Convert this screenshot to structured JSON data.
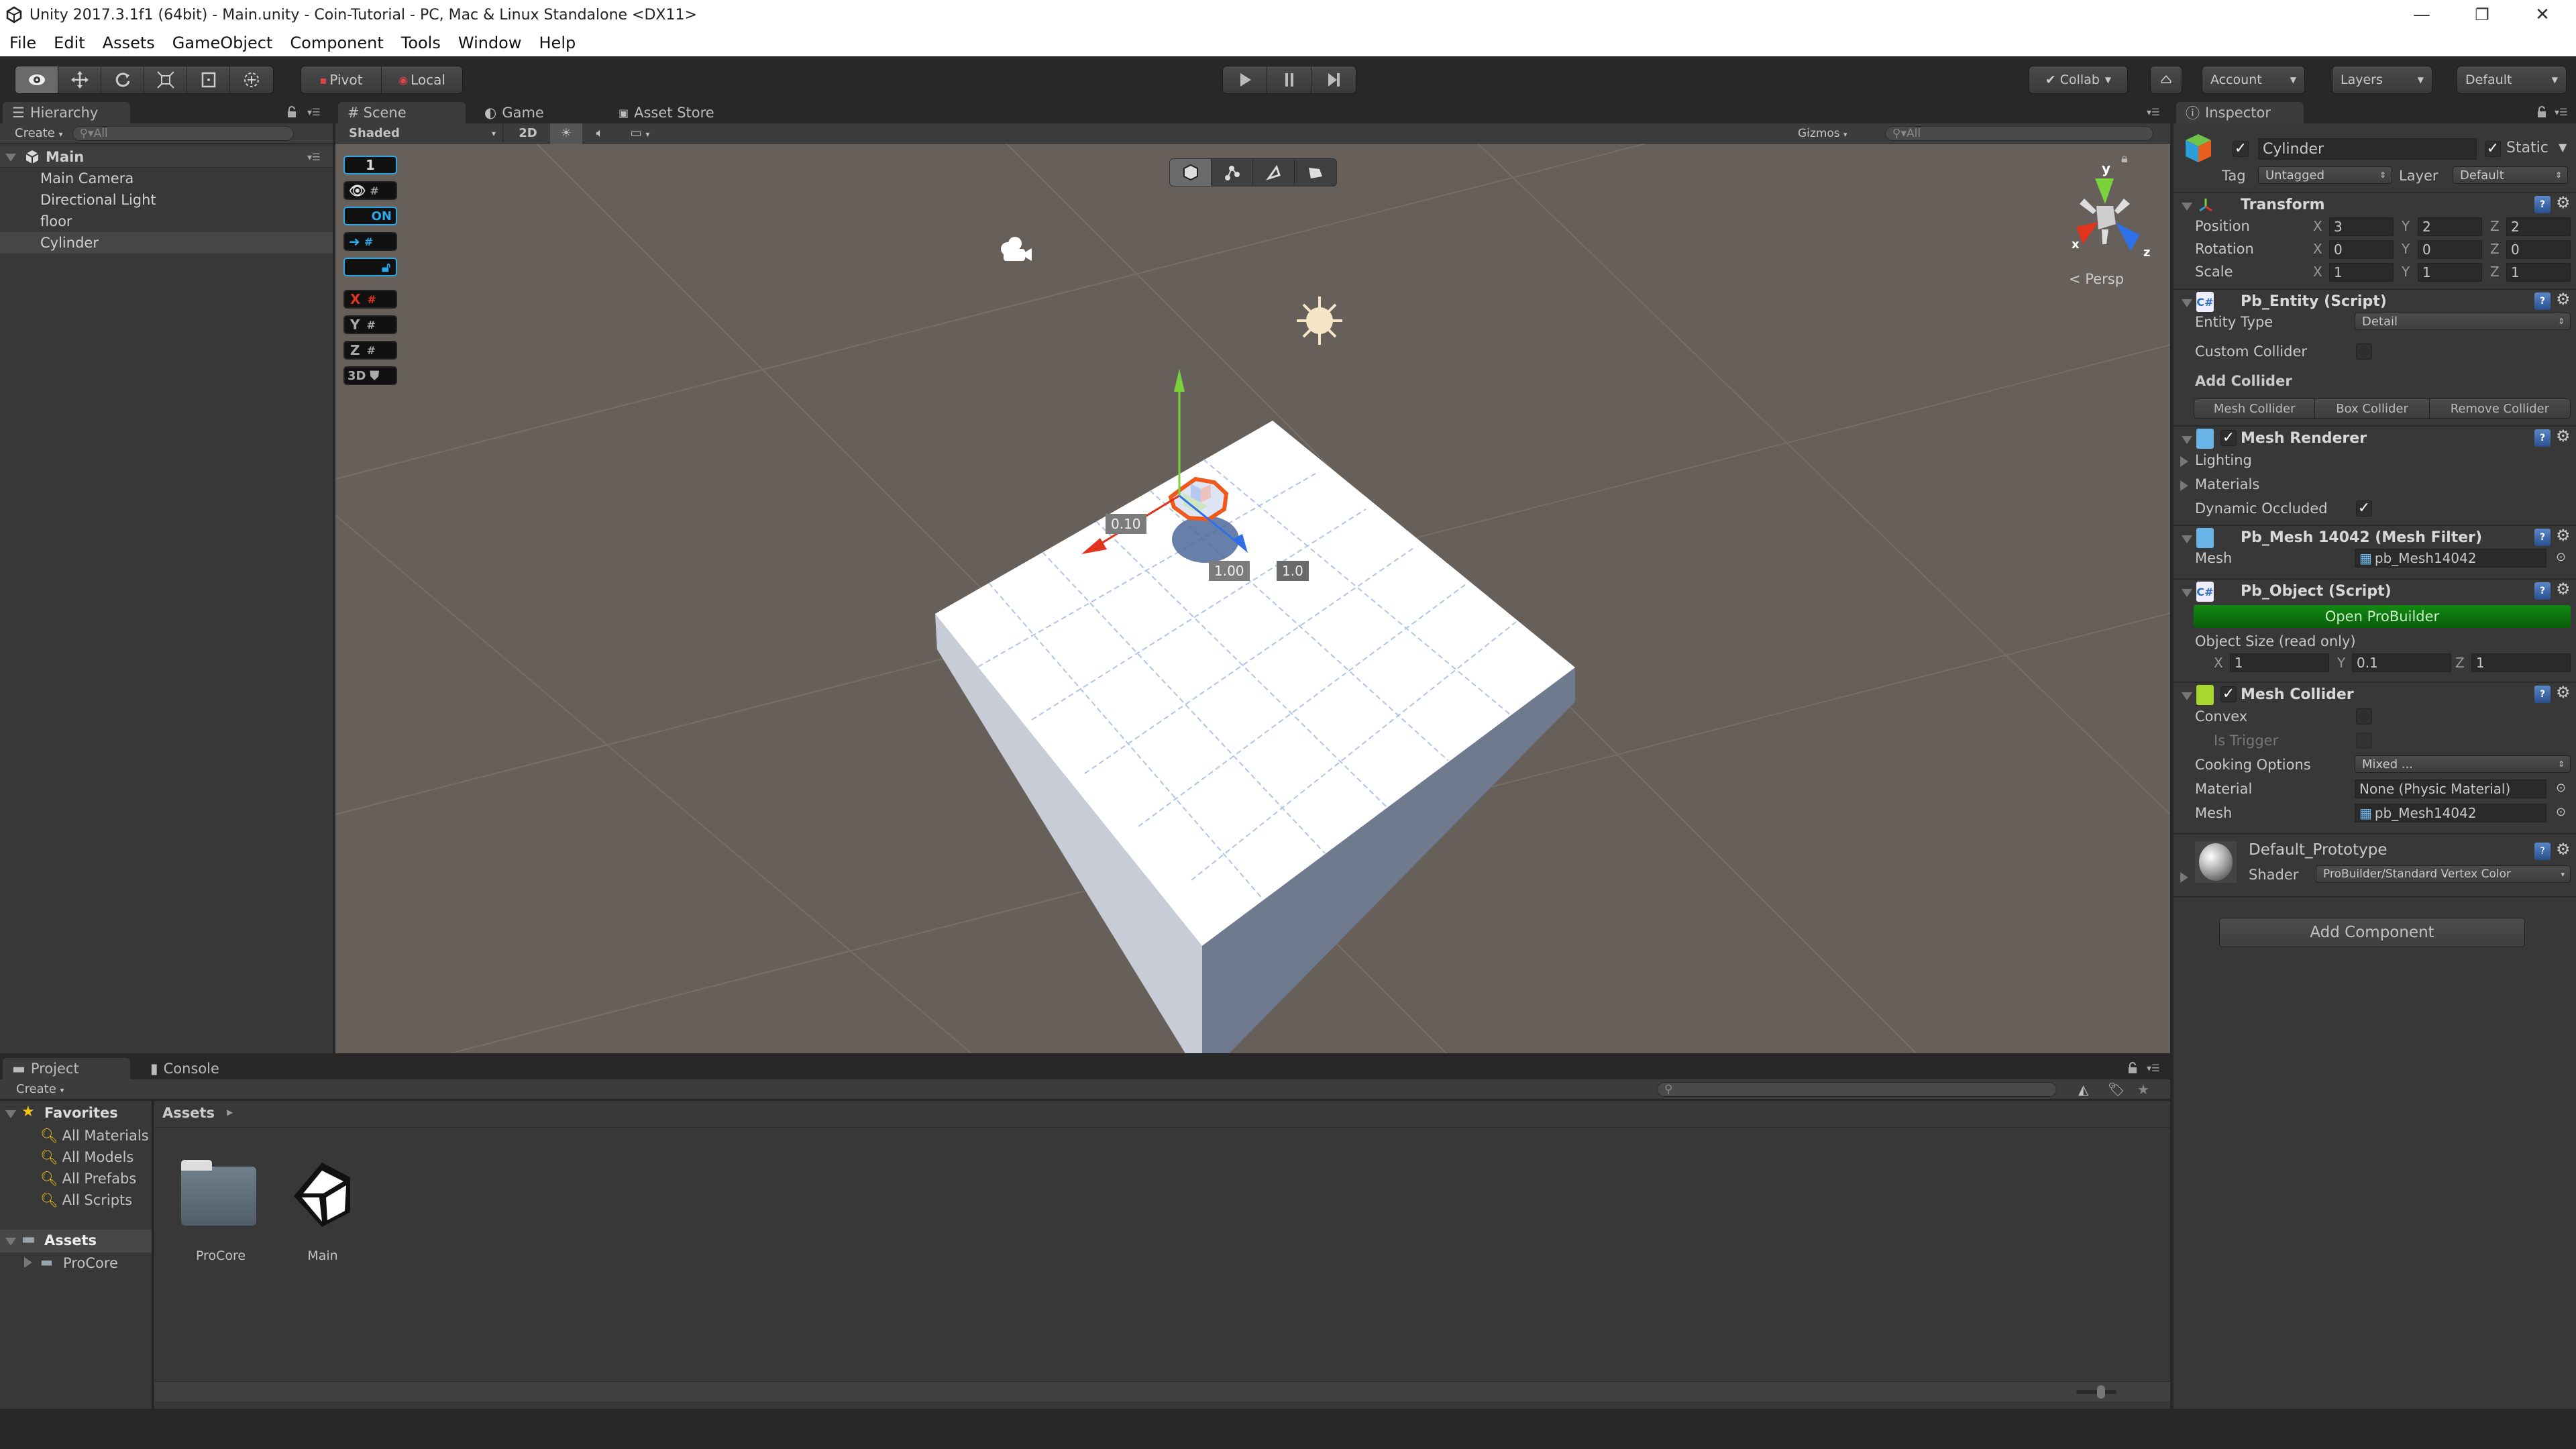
{
  "window": {
    "title": "Unity 2017.3.1f1 (64bit) - Main.unity - Coin-Tutorial - PC, Mac & Linux Standalone <DX11>",
    "controls": {
      "minimize": "—",
      "restore": "❐",
      "close": "✕"
    }
  },
  "menubar": [
    "File",
    "Edit",
    "Assets",
    "GameObject",
    "Component",
    "Tools",
    "Window",
    "Help"
  ],
  "toolbar": {
    "tools": [
      {
        "name": "view-tool",
        "icon": "eye-icon",
        "active": true
      },
      {
        "name": "move-tool",
        "icon": "move-arrows-icon"
      },
      {
        "name": "rotate-tool",
        "icon": "rotate-icon"
      },
      {
        "name": "scale-tool",
        "icon": "scale-icon"
      },
      {
        "name": "rect-tool",
        "icon": "rect-icon"
      },
      {
        "name": "transform-tool",
        "icon": "transform-icon"
      }
    ],
    "pivot_label": "Pivot",
    "local_label": "Local",
    "play": "play-icon",
    "pause": "pause-icon",
    "step": "step-icon",
    "collab_label": "Collab",
    "account_label": "Account",
    "layers_label": "Layers",
    "layout_label": "Default"
  },
  "hierarchy": {
    "tab_label": "Hierarchy",
    "create_label": "Create",
    "search_placeholder": "All",
    "scene_name": "Main",
    "items": [
      "Main Camera",
      "Directional Light",
      "floor",
      "Cylinder"
    ],
    "selected": "Cylinder"
  },
  "scene_tabs": {
    "tabs": [
      "Scene",
      "Game",
      "Asset Store"
    ],
    "active": "Scene",
    "shading_mode": "Shaded",
    "mode_2d": "2D",
    "gizmos_label": "Gizmos",
    "search_placeholder": "All"
  },
  "scene": {
    "probuilder_overlay": [
      "1",
      "ON",
      "X",
      "Y",
      "Z",
      "3D"
    ],
    "edit_modes": [
      "object-mode",
      "vertex-mode",
      "edge-mode",
      "face-mode"
    ],
    "gizmo_axes": {
      "x": "x",
      "y": "y",
      "z": "z"
    },
    "projection": "Persp",
    "dimension_labels": [
      "0.10",
      "1.00",
      "1.0"
    ]
  },
  "inspector": {
    "tab_label": "Inspector",
    "object_name": "Cylinder",
    "active": true,
    "static_label": "Static",
    "static": true,
    "tag_label": "Tag",
    "tag_value": "Untagged",
    "layer_label": "Layer",
    "layer_value": "Default",
    "transform": {
      "title": "Transform",
      "position_label": "Position",
      "rotation_label": "Rotation",
      "scale_label": "Scale",
      "position": {
        "x": "3",
        "y": "2",
        "z": "2"
      },
      "rotation": {
        "x": "0",
        "y": "0",
        "z": "0"
      },
      "scale": {
        "x": "1",
        "y": "1",
        "z": "1"
      }
    },
    "pb_entity": {
      "title": "Pb_Entity (Script)",
      "entity_type_label": "Entity Type",
      "entity_type_value": "Detail",
      "custom_collider_label": "Custom Collider",
      "custom_collider": false,
      "add_collider_label": "Add Collider",
      "buttons": [
        "Mesh Collider",
        "Box Collider",
        "Remove Collider"
      ]
    },
    "mesh_renderer": {
      "title": "Mesh Renderer",
      "enabled": true,
      "lighting_label": "Lighting",
      "materials_label": "Materials",
      "dynamic_occluded_label": "Dynamic Occluded",
      "dynamic_occluded": true
    },
    "mesh_filter": {
      "title": "Pb_Mesh 14042 (Mesh Filter)",
      "mesh_label": "Mesh",
      "mesh_value": "pb_Mesh14042"
    },
    "pb_object": {
      "title": "Pb_Object (Script)",
      "open_button": "Open ProBuilder",
      "size_label": "Object Size (read only)",
      "size": {
        "x": "1",
        "y": "0.1",
        "z": "1"
      }
    },
    "mesh_collider": {
      "title": "Mesh Collider",
      "enabled": true,
      "convex_label": "Convex",
      "convex": false,
      "is_trigger_label": "Is Trigger",
      "is_trigger": false,
      "cooking_label": "Cooking Options",
      "cooking_value": "Mixed ...",
      "material_label": "Material",
      "material_value": "None (Physic Material)",
      "mesh_label": "Mesh",
      "mesh_value": "pb_Mesh14042"
    },
    "material": {
      "name": "Default_Prototype",
      "shader_label": "Shader",
      "shader_value": "ProBuilder/Standard Vertex Color"
    },
    "add_component_label": "Add Component",
    "axis": {
      "x": "X",
      "y": "Y",
      "z": "Z"
    }
  },
  "project": {
    "tabs": [
      "Project",
      "Console"
    ],
    "active": "Project",
    "create_label": "Create",
    "favorites_label": "Favorites",
    "favorites": [
      "All Materials",
      "All Models",
      "All Prefabs",
      "All Scripts"
    ],
    "assets_label": "Assets",
    "asset_tree": [
      "ProCore"
    ],
    "breadcrumb": "Assets",
    "items": [
      {
        "name": "ProCore",
        "type": "folder"
      },
      {
        "name": "Main",
        "type": "unity-scene"
      }
    ],
    "zoom_slider": 0.55
  },
  "colors": {
    "accent_green": "#0e6b0e",
    "selection_orange": "#f0581c",
    "axis_x": "#e0341c",
    "axis_y": "#7ad33a",
    "axis_z": "#2f6fe8",
    "scene_bg": "#67605a"
  }
}
